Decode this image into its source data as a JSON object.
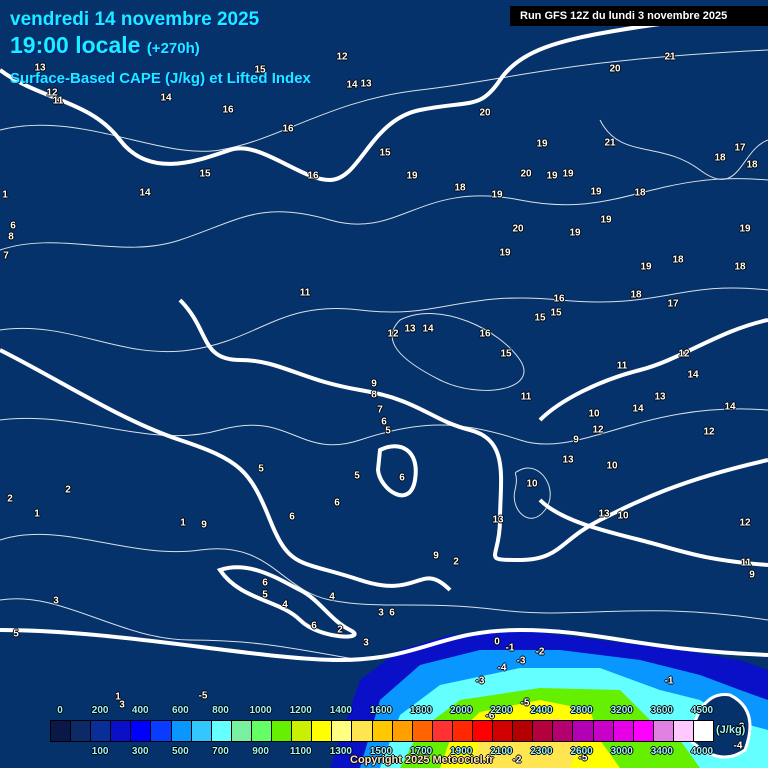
{
  "header": {
    "date": "vendredi 14 novembre 2025",
    "time": "19:00 locale",
    "lead": "(+270h)",
    "product": "Surface-Based CAPE (J/kg) et Lifted Index",
    "run": "Run GFS 12Z du lundi 3 novembre 2025"
  },
  "legend": {
    "unit": "(J/kg)",
    "top_ticks": [
      "0",
      "200",
      "400",
      "600",
      "800",
      "1000",
      "1200",
      "1400",
      "1600",
      "1800",
      "2000",
      "2200",
      "2400",
      "2800",
      "3200",
      "3600",
      "4500"
    ],
    "bottom_ticks": [
      "100",
      "300",
      "500",
      "700",
      "900",
      "1100",
      "1300",
      "1500",
      "1700",
      "1900",
      "2100",
      "2300",
      "2600",
      "3000",
      "3400",
      "4000"
    ],
    "colors": [
      "#0a1848",
      "#0c2a66",
      "#0a2e98",
      "#0a10c8",
      "#0000ff",
      "#0a3cff",
      "#0a96ff",
      "#32c8ff",
      "#64ffff",
      "#78f0a0",
      "#64ff64",
      "#64f000",
      "#c8f000",
      "#ffff00",
      "#ffff80",
      "#ffe650",
      "#ffc800",
      "#ffa000",
      "#ff6400",
      "#ff3232",
      "#ff2800",
      "#ff0000",
      "#d20000",
      "#b40000",
      "#b4003c",
      "#b4006e",
      "#b400b4",
      "#c800c8",
      "#e600e6",
      "#ff00ff",
      "#e080e0",
      "#ffc8ff",
      "#ffffff"
    ]
  },
  "lifted_index_labels": [
    "12",
    "14",
    "13",
    "12",
    "11",
    "13",
    "14",
    "16",
    "16",
    "15",
    "14",
    "16",
    "15",
    "15",
    "19",
    "18",
    "19",
    "20",
    "19",
    "20",
    "19",
    "19",
    "21",
    "20",
    "21",
    "18",
    "17",
    "18",
    "19",
    "18",
    "19",
    "20",
    "19",
    "19",
    "19",
    "19",
    "18",
    "18",
    "18",
    "17",
    "16",
    "15",
    "15",
    "11",
    "12",
    "13",
    "14",
    "16",
    "15",
    "11",
    "12",
    "14",
    "13",
    "14",
    "14",
    "12",
    "11",
    "10",
    "12",
    "9",
    "13",
    "10",
    "9",
    "8",
    "7",
    "6",
    "5",
    "5",
    "5",
    "6",
    "6",
    "6",
    "10",
    "13",
    "13",
    "10",
    "12",
    "11",
    "9",
    "9",
    "2",
    "2",
    "1",
    "2",
    "1",
    "9",
    "6",
    "5",
    "4",
    "4",
    "3",
    "6",
    "6",
    "2",
    "3",
    "3",
    "5",
    "7",
    "6",
    "8",
    "1",
    "0",
    "-1",
    "-2",
    "-3",
    "-4",
    "-3",
    "-1",
    "1",
    "3",
    "-5",
    "-6",
    "-5",
    "-2",
    "-3",
    "-4",
    "-5"
  ],
  "copyright": "Copyright 2025 Meteociel.fr",
  "colors": {
    "background": "#05326a",
    "title": "#16f0ff"
  }
}
